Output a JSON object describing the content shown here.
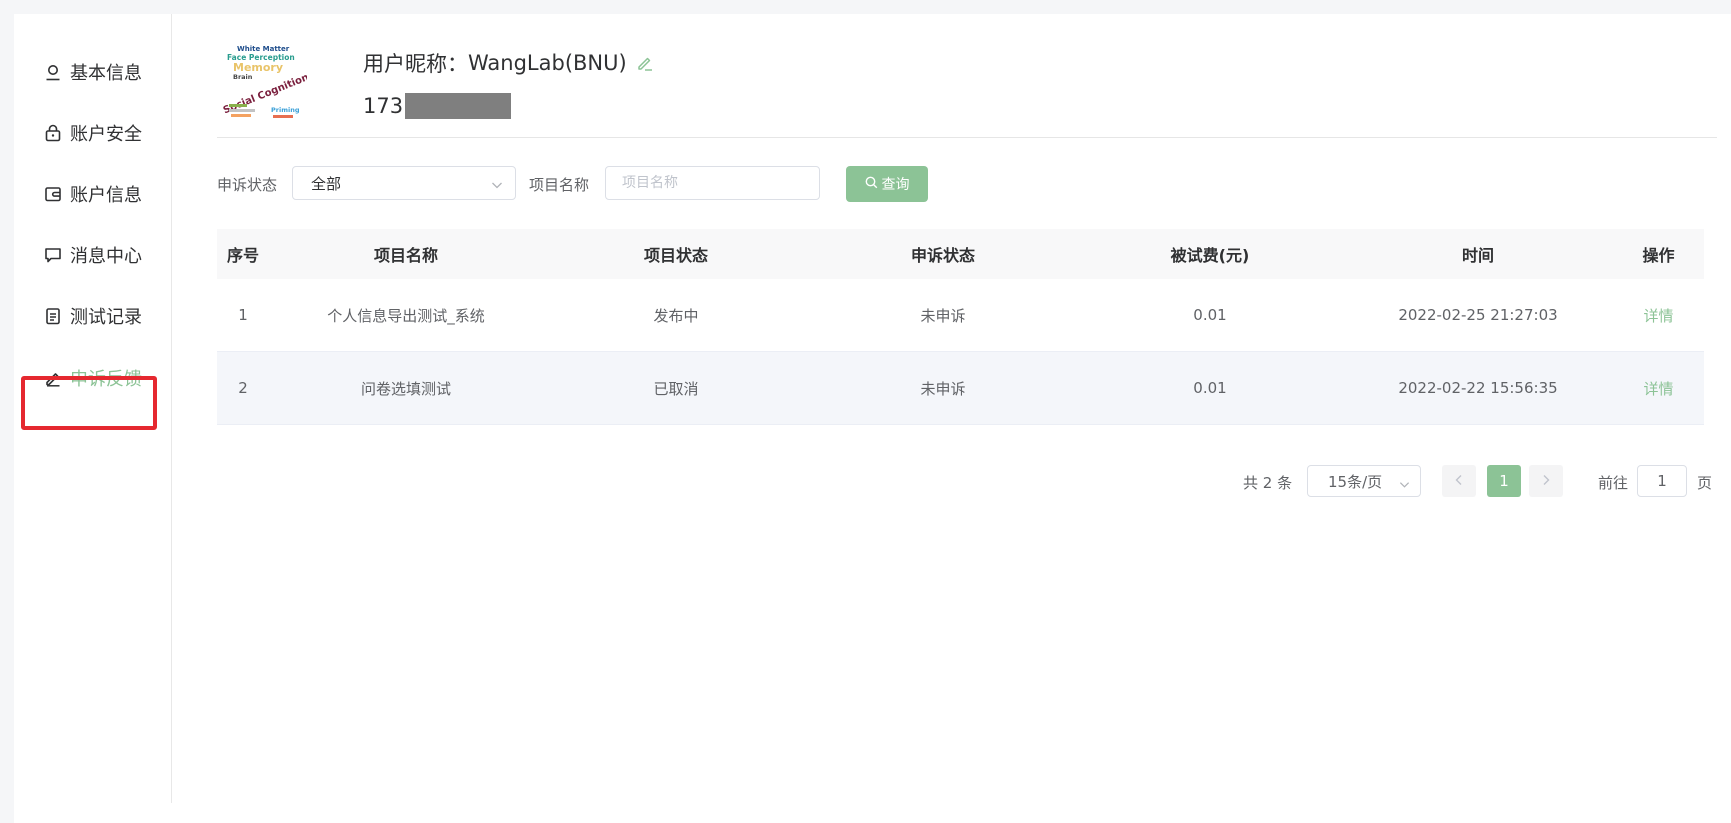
{
  "sidebar": {
    "items": [
      {
        "label": "基本信息",
        "icon": "user-icon"
      },
      {
        "label": "账户安全",
        "icon": "lock-icon"
      },
      {
        "label": "账户信息",
        "icon": "wallet-icon"
      },
      {
        "label": "消息中心",
        "icon": "message-icon"
      },
      {
        "label": "测试记录",
        "icon": "document-icon"
      },
      {
        "label": "申诉反馈",
        "icon": "edit-icon",
        "active": true
      }
    ]
  },
  "profile": {
    "nickname_label": "用户昵称：",
    "nickname": "WangLab(BNU)",
    "phone_prefix": "173",
    "avatar_words": [
      "White Matter",
      "Face Perception",
      "Memory",
      "Brain",
      "Social Cognition",
      "Priming"
    ]
  },
  "filters": {
    "status_label": "申诉状态",
    "status_value": "全部",
    "project_label": "项目名称",
    "project_placeholder": "项目名称",
    "query_button": "查询"
  },
  "table": {
    "headers": [
      "序号",
      "项目名称",
      "项目状态",
      "申诉状态",
      "被试费(元)",
      "时间",
      "操作"
    ],
    "rows": [
      {
        "index": "1",
        "name": "个人信息导出测试_系统",
        "project_status": "发布中",
        "appeal_status": "未申诉",
        "fee": "0.01",
        "time": "2022-02-25 21:27:03",
        "action": "详情"
      },
      {
        "index": "2",
        "name": "问卷选填测试",
        "project_status": "已取消",
        "appeal_status": "未申诉",
        "fee": "0.01",
        "time": "2022-02-22 15:56:35",
        "action": "详情"
      }
    ]
  },
  "pagination": {
    "total": "共 2 条",
    "page_size": "15条/页",
    "current_page": "1",
    "goto_label": "前往",
    "goto_value": "1",
    "page_unit": "页"
  },
  "colors": {
    "accent": "#8cc396",
    "highlight_box": "#e5282f"
  }
}
